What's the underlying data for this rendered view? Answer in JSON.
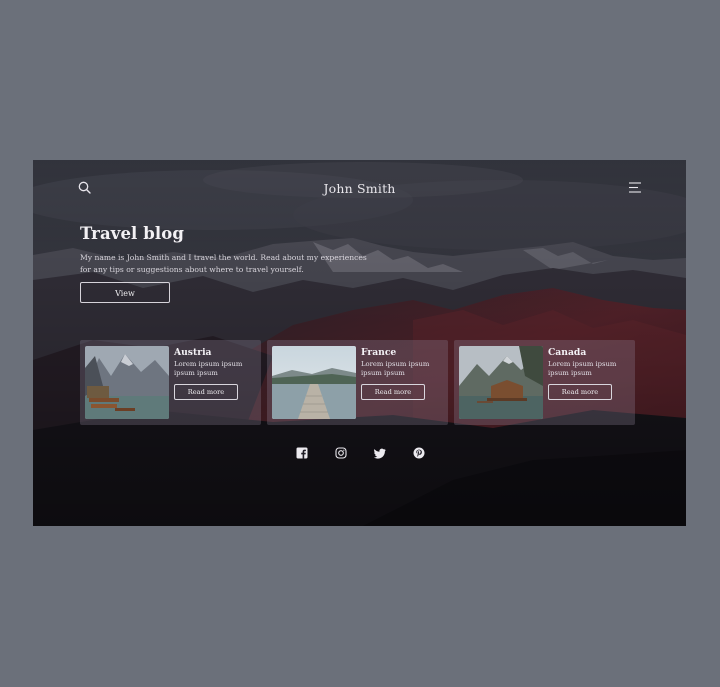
{
  "header": {
    "brand": "John Smith",
    "search_icon": "search-icon",
    "menu_icon": "hamburger-menu-icon"
  },
  "hero": {
    "title": "Travel blog",
    "description": "My name is John Smith and I travel the world. Read about my experiences for any tips or suggestions about where to travel yourself.",
    "button_label": "View"
  },
  "cards": [
    {
      "title": "Austria",
      "text": "Lorem ipsum ipsum ipsum ipsum",
      "button": "Read more",
      "image": "alpine-lake-boats-photo"
    },
    {
      "title": "France",
      "text": "Lorem ipsum ipsum ipsum ipsum",
      "button": "Read more",
      "image": "lake-pier-photo"
    },
    {
      "title": "Canada",
      "text": "Lorem ipsum ipsum ipsum ipsum",
      "button": "Read more",
      "image": "lake-cabin-photo"
    }
  ],
  "social": {
    "icons": [
      "facebook-icon",
      "instagram-icon",
      "twitter-icon",
      "pinterest-icon"
    ]
  },
  "colors": {
    "page_background": "#6b707a",
    "hero_dark": "#1c1b24",
    "mountain_red": "#6e2a32",
    "text_light": "#f3f1f4"
  }
}
